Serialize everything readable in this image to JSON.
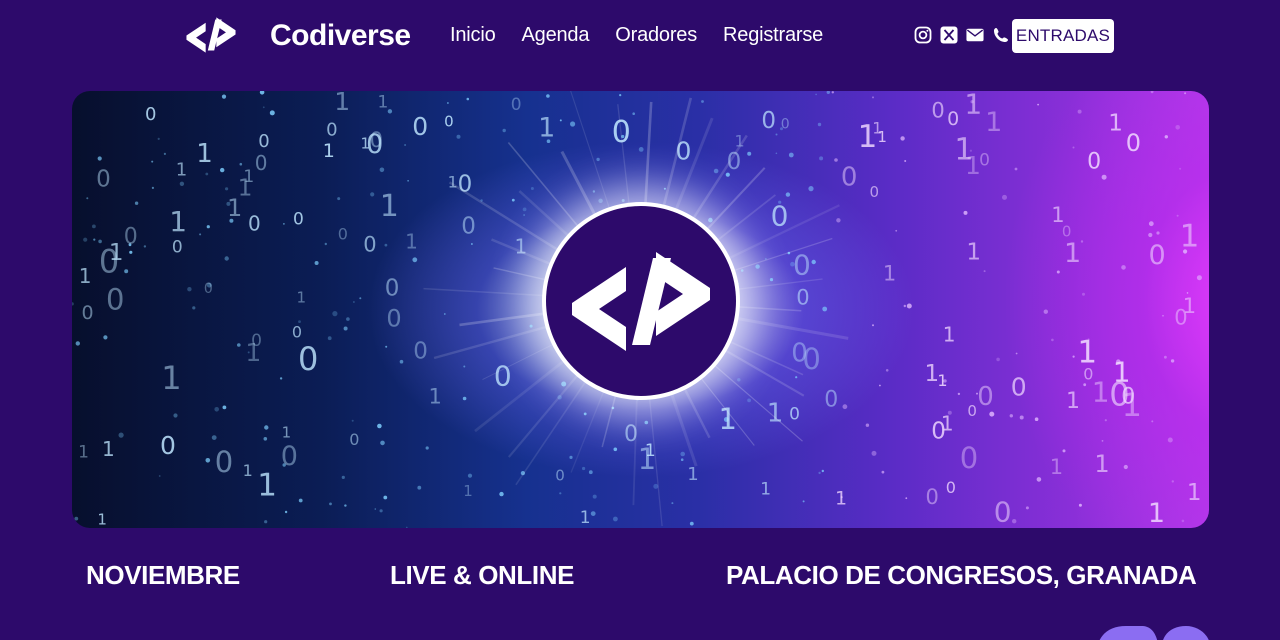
{
  "header": {
    "brand_name": "Codiverse",
    "logo_icon": "code-brackets-logo",
    "nav": [
      {
        "label": "Inicio"
      },
      {
        "label": "Agenda"
      },
      {
        "label": "Oradores"
      },
      {
        "label": "Registrarse"
      }
    ],
    "socials": [
      {
        "icon": "instagram-icon"
      },
      {
        "icon": "x-icon"
      },
      {
        "icon": "mail-icon"
      },
      {
        "icon": "phone-icon"
      }
    ],
    "cta_label": "ENTRADAS"
  },
  "hero": {
    "logo_icon": "code-brackets-logo",
    "binary_digits": [
      "0",
      "1"
    ]
  },
  "info": {
    "month": "NOVIEMBRE",
    "mode": "LIVE & ONLINE",
    "venue": "PALACIO DE CONGRESOS, GRANADA"
  },
  "colors": {
    "background": "#2d0a6b",
    "button_bg": "#ffffff",
    "button_text": "#2d0a6b",
    "accent_purple": "#b13ae8",
    "accent_blue": "#16318f"
  }
}
